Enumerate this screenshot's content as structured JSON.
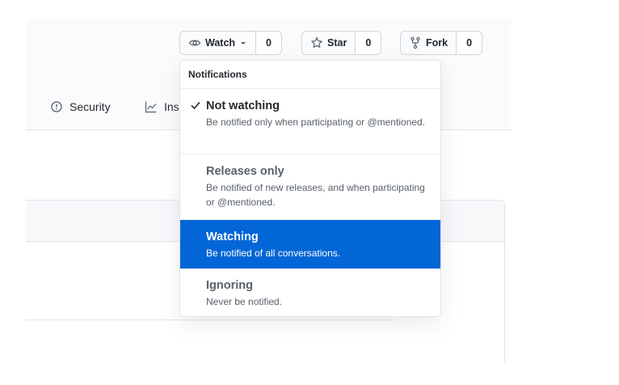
{
  "header": {
    "watch": {
      "label": "Watch",
      "count": "0"
    },
    "star": {
      "label": "Star",
      "count": "0"
    },
    "fork": {
      "label": "Fork",
      "count": "0"
    }
  },
  "tabs": [
    {
      "label": "Security",
      "icon": "shield-icon"
    },
    {
      "label": "Ins",
      "icon": "graph-icon"
    }
  ],
  "notifications": {
    "title": "Notifications",
    "options": [
      {
        "title": "Not watching",
        "description": "Be notified only when participating or @mentioned.",
        "selected": true
      },
      {
        "title": "Releases only",
        "description": "Be notified of new releases, and when participating or @mentioned."
      },
      {
        "title": "Watching",
        "description": "Be notified of all conversations.",
        "highlighted": true
      },
      {
        "title": "Ignoring",
        "description": "Never be notified."
      }
    ]
  },
  "colors": {
    "highlight": "#0366d6",
    "border": "#e1e4e8",
    "text": "#24292e",
    "muted": "#586069"
  }
}
